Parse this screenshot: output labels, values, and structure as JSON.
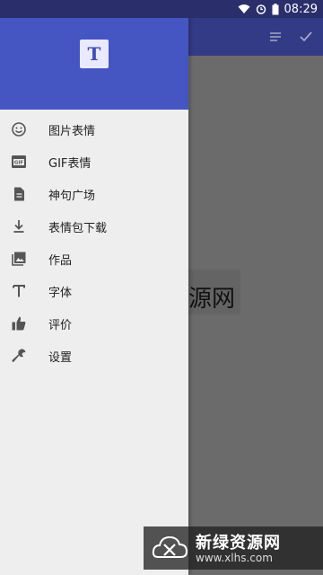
{
  "status_bar": {
    "time": "08:29"
  },
  "drawer": {
    "logo_letter": "T",
    "items": [
      {
        "label": "图片表情",
        "icon": "emoji-smile-icon"
      },
      {
        "label": "GIF表情",
        "icon": "gif-icon"
      },
      {
        "label": "神句广场",
        "icon": "document-icon"
      },
      {
        "label": "表情包下载",
        "icon": "download-icon"
      },
      {
        "label": "作品",
        "icon": "image-gallery-icon"
      },
      {
        "label": "字体",
        "icon": "text-t-icon"
      },
      {
        "label": "评价",
        "icon": "thumbs-up-icon"
      },
      {
        "label": "设置",
        "icon": "wrench-icon"
      }
    ]
  },
  "main": {
    "preview_text": "源网"
  },
  "watermark": {
    "title": "新绿资源网",
    "url": "www.xlhs.com"
  },
  "colors": {
    "status_bar": "#2a2f6c",
    "app_bar": "#343b86",
    "drawer_header": "#4556c2",
    "drawer_bg": "#eeeeee"
  }
}
